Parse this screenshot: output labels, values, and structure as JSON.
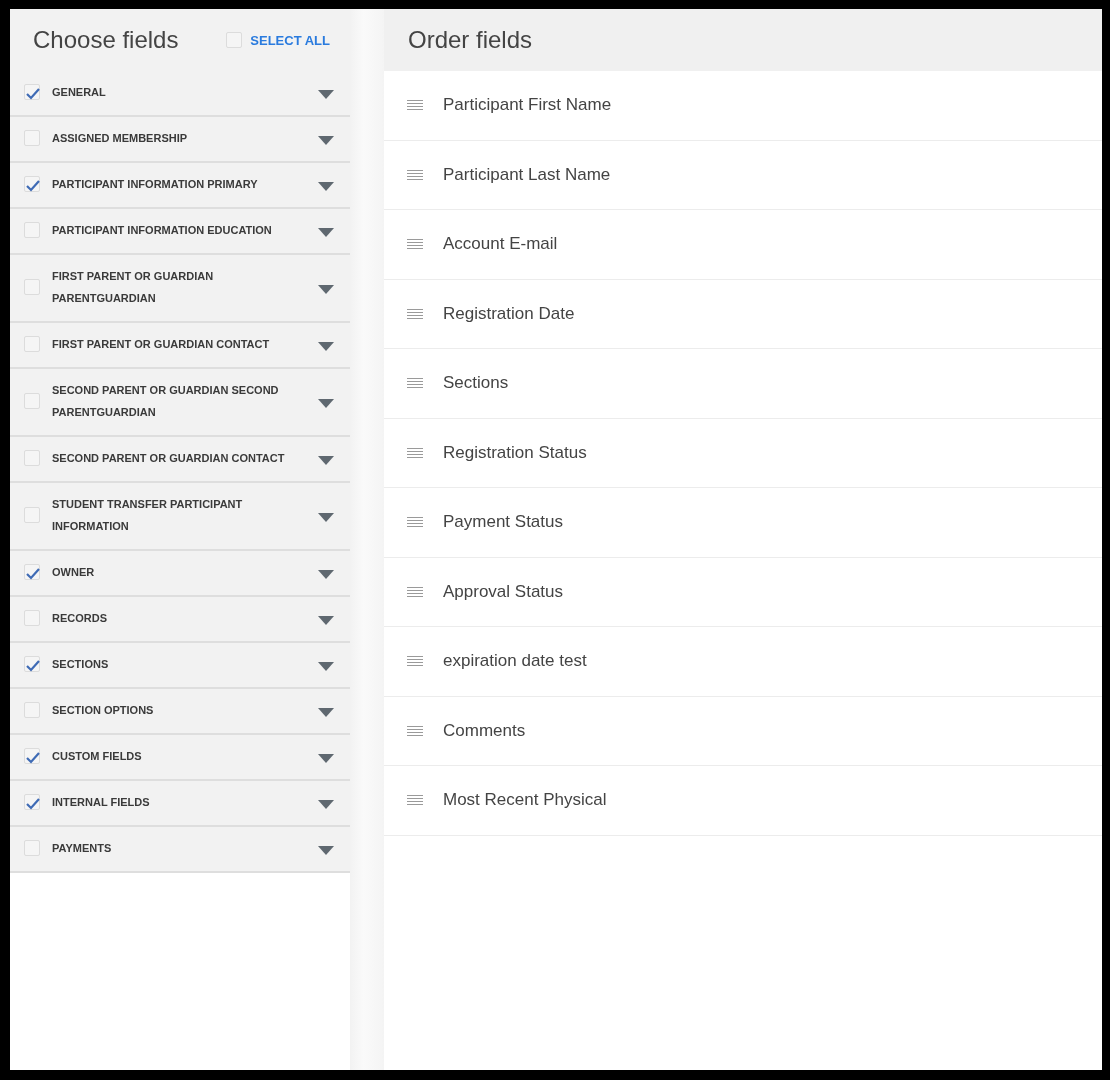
{
  "choose_panel": {
    "title": "Choose fields",
    "select_all": {
      "label": "SELECT ALL",
      "checked": false
    },
    "groups": [
      {
        "label": "GENERAL",
        "checked": true
      },
      {
        "label": "ASSIGNED MEMBERSHIP",
        "checked": false
      },
      {
        "label": "PARTICIPANT INFORMATION PRIMARY",
        "checked": true
      },
      {
        "label": "PARTICIPANT INFORMATION EDUCATION",
        "checked": false
      },
      {
        "label": "FIRST PARENT OR GUARDIAN PARENTGUARDIAN",
        "checked": false
      },
      {
        "label": "FIRST PARENT OR GUARDIAN CONTACT",
        "checked": false
      },
      {
        "label": "SECOND PARENT OR GUARDIAN SECOND PARENTGUARDIAN",
        "checked": false
      },
      {
        "label": "SECOND PARENT OR GUARDIAN CONTACT",
        "checked": false
      },
      {
        "label": "STUDENT TRANSFER PARTICIPANT INFORMATION",
        "checked": false
      },
      {
        "label": "OWNER",
        "checked": true
      },
      {
        "label": "RECORDS",
        "checked": false
      },
      {
        "label": "SECTIONS",
        "checked": true
      },
      {
        "label": "SECTION OPTIONS",
        "checked": false
      },
      {
        "label": "CUSTOM FIELDS",
        "checked": true
      },
      {
        "label": "INTERNAL FIELDS",
        "checked": true
      },
      {
        "label": "PAYMENTS",
        "checked": false
      }
    ]
  },
  "order_panel": {
    "title": "Order fields",
    "fields": [
      {
        "label": "Participant First Name"
      },
      {
        "label": "Participant Last Name"
      },
      {
        "label": "Account E-mail"
      },
      {
        "label": "Registration Date"
      },
      {
        "label": "Sections"
      },
      {
        "label": "Registration Status"
      },
      {
        "label": "Payment Status"
      },
      {
        "label": "Approval Status"
      },
      {
        "label": "expiration date test"
      },
      {
        "label": "Comments"
      },
      {
        "label": "Most Recent Physical"
      }
    ]
  }
}
